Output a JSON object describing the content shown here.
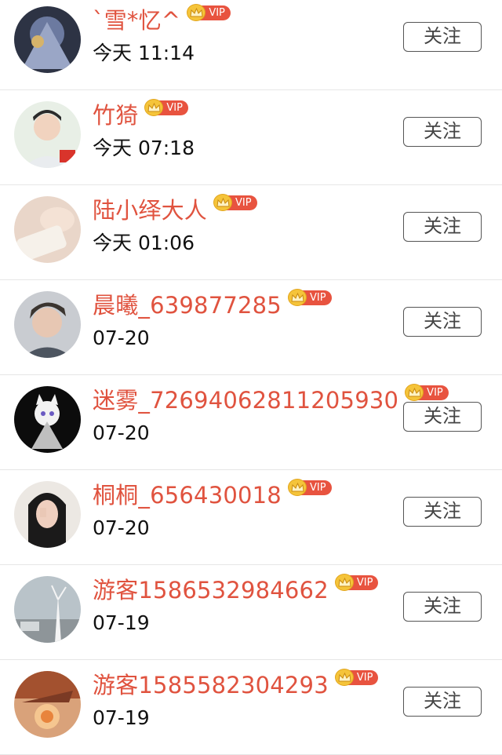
{
  "users": [
    {
      "name": "`雪*忆^",
      "vip_label": "VIP",
      "time": "今天 11:14",
      "follow_label": "关注"
    },
    {
      "name": "竹猗",
      "vip_label": "VIP",
      "time": "今天 07:18",
      "follow_label": "关注"
    },
    {
      "name": "陆小绎大人",
      "vip_label": "VIP",
      "time": "今天 01:06",
      "follow_label": "关注"
    },
    {
      "name": "晨曦_639877285",
      "vip_label": "VIP",
      "time": "07-20",
      "follow_label": "关注"
    },
    {
      "name": "迷雾_72694062811205930",
      "vip_label": "VIP",
      "time": "07-20",
      "follow_label": "关注"
    },
    {
      "name": "桐桐_656430018",
      "vip_label": "VIP",
      "time": "07-20",
      "follow_label": "关注"
    },
    {
      "name": "游客1586532984662",
      "vip_label": "VIP",
      "time": "07-19",
      "follow_label": "关注"
    },
    {
      "name": "游客1585582304293",
      "vip_label": "VIP",
      "time": "07-19",
      "follow_label": "关注"
    }
  ],
  "colors": {
    "name": "#e0533f",
    "vip_badge": "#e8533f",
    "crown": "#f5c43a",
    "divider": "#e6e6e6"
  },
  "icons": {
    "vip": "crown-icon",
    "avatar": "avatar-image"
  }
}
